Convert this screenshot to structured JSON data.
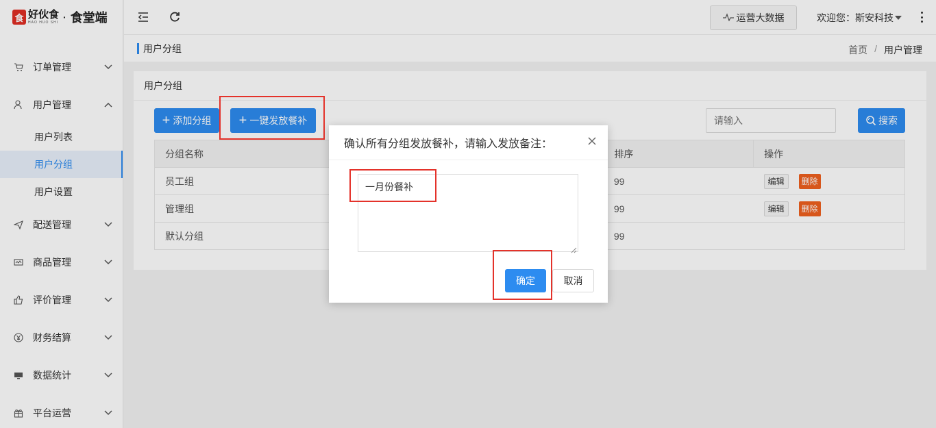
{
  "brand": {
    "logo_mark": "食",
    "name_cn": "好伙食",
    "name_en": "HAO HUO SHI",
    "dot": "·",
    "suffix": "食堂端"
  },
  "sidebar": {
    "items": [
      {
        "label": "订单管理",
        "icon": "cart-icon",
        "expanded": false
      },
      {
        "label": "用户管理",
        "icon": "user-icon",
        "expanded": true,
        "children": [
          {
            "label": "用户列表",
            "active": false
          },
          {
            "label": "用户分组",
            "active": true
          },
          {
            "label": "用户设置",
            "active": false
          }
        ]
      },
      {
        "label": "配送管理",
        "icon": "send-icon",
        "expanded": false
      },
      {
        "label": "商品管理",
        "icon": "goods-icon",
        "expanded": false
      },
      {
        "label": "评价管理",
        "icon": "thumb-icon",
        "expanded": false
      },
      {
        "label": "财务结算",
        "icon": "yuan-icon",
        "expanded": false
      },
      {
        "label": "数据统计",
        "icon": "monitor-icon",
        "expanded": false
      },
      {
        "label": "平台运营",
        "icon": "gift-icon",
        "expanded": false
      }
    ]
  },
  "topbar": {
    "bigdata_label": "运营大数据",
    "welcome": "欢迎您：斯安科技"
  },
  "breadcrumb": {
    "title": "用户分组",
    "home": "首页",
    "separator": "/",
    "current": "用户管理"
  },
  "card": {
    "title": "用户分组",
    "add_group_label": "添加分组",
    "issue_label": "一键发放餐补",
    "search_placeholder": "请输入",
    "search_label": "搜索"
  },
  "table": {
    "headers": [
      "分组名称",
      "排序",
      "操作"
    ],
    "rows": [
      {
        "name": "员工组",
        "sort": "99",
        "edit": "编辑",
        "delete": "删除",
        "has_actions": true
      },
      {
        "name": "管理组",
        "sort": "99",
        "edit": "编辑",
        "delete": "删除",
        "has_actions": true
      },
      {
        "name": "默认分组",
        "sort": "99",
        "has_actions": false
      }
    ]
  },
  "modal": {
    "title": "确认所有分组发放餐补，请输入发放备注：",
    "textarea_value": "一月份餐补",
    "ok_label": "确定",
    "cancel_label": "取消"
  },
  "colors": {
    "primary": "#2d8cf0",
    "danger": "#f0601f",
    "highlight": "#e4322a",
    "brand_red": "#e02e24"
  }
}
